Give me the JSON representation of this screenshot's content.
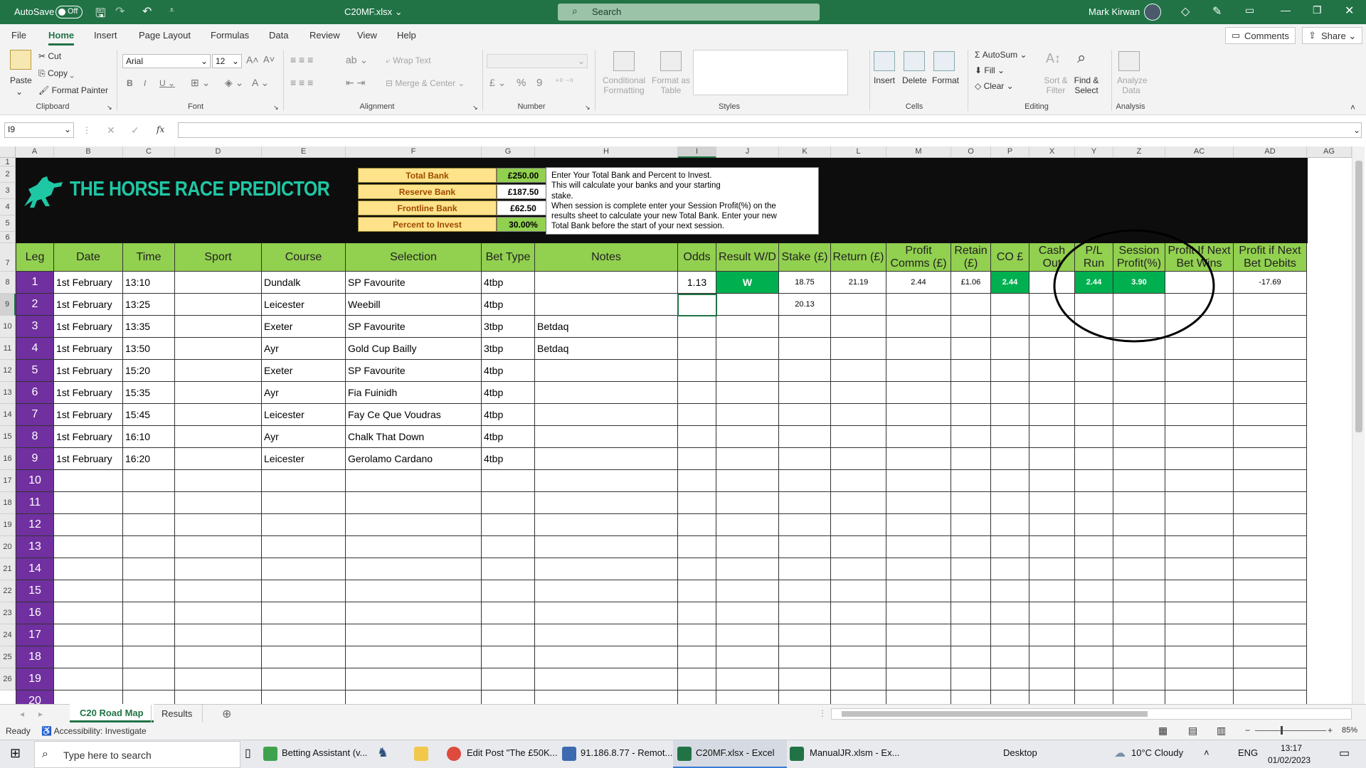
{
  "titlebar": {
    "autosave_label": "AutoSave",
    "autosave_state": "Off",
    "filename": "C20MF.xlsx",
    "search_placeholder": "Search",
    "user": "Mark Kirwan"
  },
  "menu": {
    "tabs": [
      "File",
      "Home",
      "Insert",
      "Page Layout",
      "Formulas",
      "Data",
      "Review",
      "View",
      "Help"
    ],
    "active": "Home",
    "comments": "Comments",
    "share": "Share"
  },
  "ribbon": {
    "clipboard": {
      "paste": "Paste",
      "cut": "Cut",
      "copy": "Copy",
      "format_painter": "Format Painter",
      "group": "Clipboard"
    },
    "font": {
      "name": "Arial",
      "size": "12",
      "group": "Font"
    },
    "alignment": {
      "wrap": "Wrap Text",
      "merge": "Merge & Center",
      "group": "Alignment"
    },
    "number": {
      "group": "Number",
      "currency": "£",
      "percent": "%",
      "comma": "9"
    },
    "styles": {
      "cond": "Conditional Formatting",
      "format_table": "Format as Table",
      "group": "Styles"
    },
    "cells": {
      "insert": "Insert",
      "delete": "Delete",
      "format": "Format",
      "group": "Cells"
    },
    "editing": {
      "autosum": "AutoSum",
      "fill": "Fill",
      "clear": "Clear",
      "sort": "Sort & Filter",
      "find": "Find & Select",
      "group": "Editing"
    },
    "analysis": {
      "analyze": "Analyze Data",
      "group": "Analysis"
    }
  },
  "formula_bar": {
    "name_box": "I9",
    "fx": "fx",
    "value": ""
  },
  "columns": [
    "A",
    "B",
    "C",
    "D",
    "E",
    "F",
    "G",
    "H",
    "I",
    "J",
    "K",
    "L",
    "M",
    "O",
    "P",
    "X",
    "Y",
    "Z",
    "AC",
    "AD",
    "AG"
  ],
  "row_numbers": [
    "1",
    "2",
    "3",
    "4",
    "5",
    "6",
    "7",
    "8",
    "9",
    "10",
    "11",
    "12",
    "13",
    "14",
    "15",
    "16",
    "17",
    "18",
    "19",
    "20",
    "21",
    "22",
    "23",
    "24",
    "25",
    "26"
  ],
  "banner": {
    "logo_text": "THE HORSE RACE PREDICTOR",
    "bank": [
      {
        "label": "Total Bank",
        "value": "£250.00"
      },
      {
        "label": "Reserve Bank",
        "value": "£187.50"
      },
      {
        "label": "Frontline Bank",
        "value": "£62.50"
      },
      {
        "label": "Percent to Invest",
        "value": "30.00%"
      }
    ],
    "note": [
      "Enter Your Total Bank and Percent to Invest.",
      "This will calculate your banks and your starting",
      "stake.",
      "When session is complete enter your Session Profit(%) on the",
      "results sheet to calculate your new Total Bank. Enter your new",
      "Total Bank before the start of your next session."
    ]
  },
  "table": {
    "headers": [
      "Leg",
      "Date",
      "Time",
      "Sport",
      "Course",
      "Selection",
      "Bet Type",
      "Notes",
      "Odds",
      "Result W/D",
      "Stake (£)",
      "Return (£)",
      "Profit Comms (£)",
      "Retain (£)",
      "CO £",
      "Cash Out",
      "P/L Run",
      "Session Profit(%)",
      "Profit If Next Bet Wins",
      "Profit if Next Bet Debits"
    ],
    "rows": [
      [
        "1",
        "1st February",
        "13:10",
        "",
        "Dundalk",
        "SP Favourite",
        "4tbp",
        "",
        "1.13",
        "W",
        "18.75",
        "21.19",
        "2.44",
        "£1.06",
        "2.44",
        "",
        "2.44",
        "3.90",
        "",
        "-17.69"
      ],
      [
        "2",
        "1st February",
        "13:25",
        "",
        "Leicester",
        "Weebill",
        "4tbp",
        "",
        "",
        "",
        "20.13",
        "",
        "",
        "",
        "",
        "",
        "",
        "",
        "",
        ""
      ],
      [
        "3",
        "1st February",
        "13:35",
        "",
        "Exeter",
        "SP Favourite",
        "3tbp",
        "Betdaq",
        "",
        "",
        "",
        "",
        "",
        "",
        "",
        "",
        "",
        "",
        "",
        ""
      ],
      [
        "4",
        "1st February",
        "13:50",
        "",
        "Ayr",
        "Gold Cup Bailly",
        "3tbp",
        "Betdaq",
        "",
        "",
        "",
        "",
        "",
        "",
        "",
        "",
        "",
        "",
        "",
        ""
      ],
      [
        "5",
        "1st February",
        "15:20",
        "",
        "Exeter",
        "SP Favourite",
        "4tbp",
        "",
        "",
        "",
        "",
        "",
        "",
        "",
        "",
        "",
        "",
        "",
        "",
        ""
      ],
      [
        "6",
        "1st February",
        "15:35",
        "",
        "Ayr",
        "Fia Fuinidh",
        "4tbp",
        "",
        "",
        "",
        "",
        "",
        "",
        "",
        "",
        "",
        "",
        "",
        "",
        ""
      ],
      [
        "7",
        "1st February",
        "15:45",
        "",
        "Leicester",
        "Fay Ce Que Voudras",
        "4tbp",
        "",
        "",
        "",
        "",
        "",
        "",
        "",
        "",
        "",
        "",
        "",
        "",
        ""
      ],
      [
        "8",
        "1st February",
        "16:10",
        "",
        "Ayr",
        "Chalk That Down",
        "4tbp",
        "",
        "",
        "",
        "",
        "",
        "",
        "",
        "",
        "",
        "",
        "",
        "",
        ""
      ],
      [
        "9",
        "1st February",
        "16:20",
        "",
        "Leicester",
        "Gerolamo Cardano",
        "4tbp",
        "",
        "",
        "",
        "",
        "",
        "",
        "",
        "",
        "",
        "",
        "",
        "",
        ""
      ],
      [
        "10",
        "",
        "",
        "",
        "",
        "",
        "",
        "",
        "",
        "",
        "",
        "",
        "",
        "",
        "",
        "",
        "",
        "",
        "",
        ""
      ],
      [
        "11",
        "",
        "",
        "",
        "",
        "",
        "",
        "",
        "",
        "",
        "",
        "",
        "",
        "",
        "",
        "",
        "",
        "",
        "",
        ""
      ],
      [
        "12",
        "",
        "",
        "",
        "",
        "",
        "",
        "",
        "",
        "",
        "",
        "",
        "",
        "",
        "",
        "",
        "",
        "",
        "",
        ""
      ],
      [
        "13",
        "",
        "",
        "",
        "",
        "",
        "",
        "",
        "",
        "",
        "",
        "",
        "",
        "",
        "",
        "",
        "",
        "",
        "",
        ""
      ],
      [
        "14",
        "",
        "",
        "",
        "",
        "",
        "",
        "",
        "",
        "",
        "",
        "",
        "",
        "",
        "",
        "",
        "",
        "",
        "",
        ""
      ],
      [
        "15",
        "",
        "",
        "",
        "",
        "",
        "",
        "",
        "",
        "",
        "",
        "",
        "",
        "",
        "",
        "",
        "",
        "",
        "",
        ""
      ],
      [
        "16",
        "",
        "",
        "",
        "",
        "",
        "",
        "",
        "",
        "",
        "",
        "",
        "",
        "",
        "",
        "",
        "",
        "",
        "",
        ""
      ],
      [
        "17",
        "",
        "",
        "",
        "",
        "",
        "",
        "",
        "",
        "",
        "",
        "",
        "",
        "",
        "",
        "",
        "",
        "",
        "",
        ""
      ],
      [
        "18",
        "",
        "",
        "",
        "",
        "",
        "",
        "",
        "",
        "",
        "",
        "",
        "",
        "",
        "",
        "",
        "",
        "",
        "",
        ""
      ],
      [
        "19",
        "",
        "",
        "",
        "",
        "",
        "",
        "",
        "",
        "",
        "",
        "",
        "",
        "",
        "",
        "",
        "",
        "",
        "",
        ""
      ],
      [
        "20",
        "",
        "",
        "",
        "",
        "",
        "",
        "",
        "",
        "",
        "",
        "",
        "",
        "",
        "",
        "",
        "",
        "",
        "",
        ""
      ]
    ]
  },
  "sheet_tabs": {
    "tabs": [
      "C20 Road Map",
      "Results"
    ],
    "active": "C20 Road Map"
  },
  "status": {
    "ready": "Ready",
    "accessibility": "Accessibility: Investigate",
    "zoom": "85%"
  },
  "taskbar": {
    "search": "Type here to search",
    "apps": [
      "Betting Assistant (v...",
      "Edit Post \"The £50K...",
      "91.186.8.77 - Remot...",
      "C20MF.xlsx - Excel",
      "ManualJR.xlsm - Ex..."
    ],
    "desktop": "Desktop",
    "weather": "10°C  Cloudy",
    "lang": "ENG",
    "time": "13:17",
    "date": "01/02/2023"
  },
  "colors": {
    "excel_green": "#217346",
    "header_green": "#92d050",
    "leg_purple": "#7030a0",
    "win_green": "#00b050",
    "bank_yellow": "#ffe38a"
  }
}
